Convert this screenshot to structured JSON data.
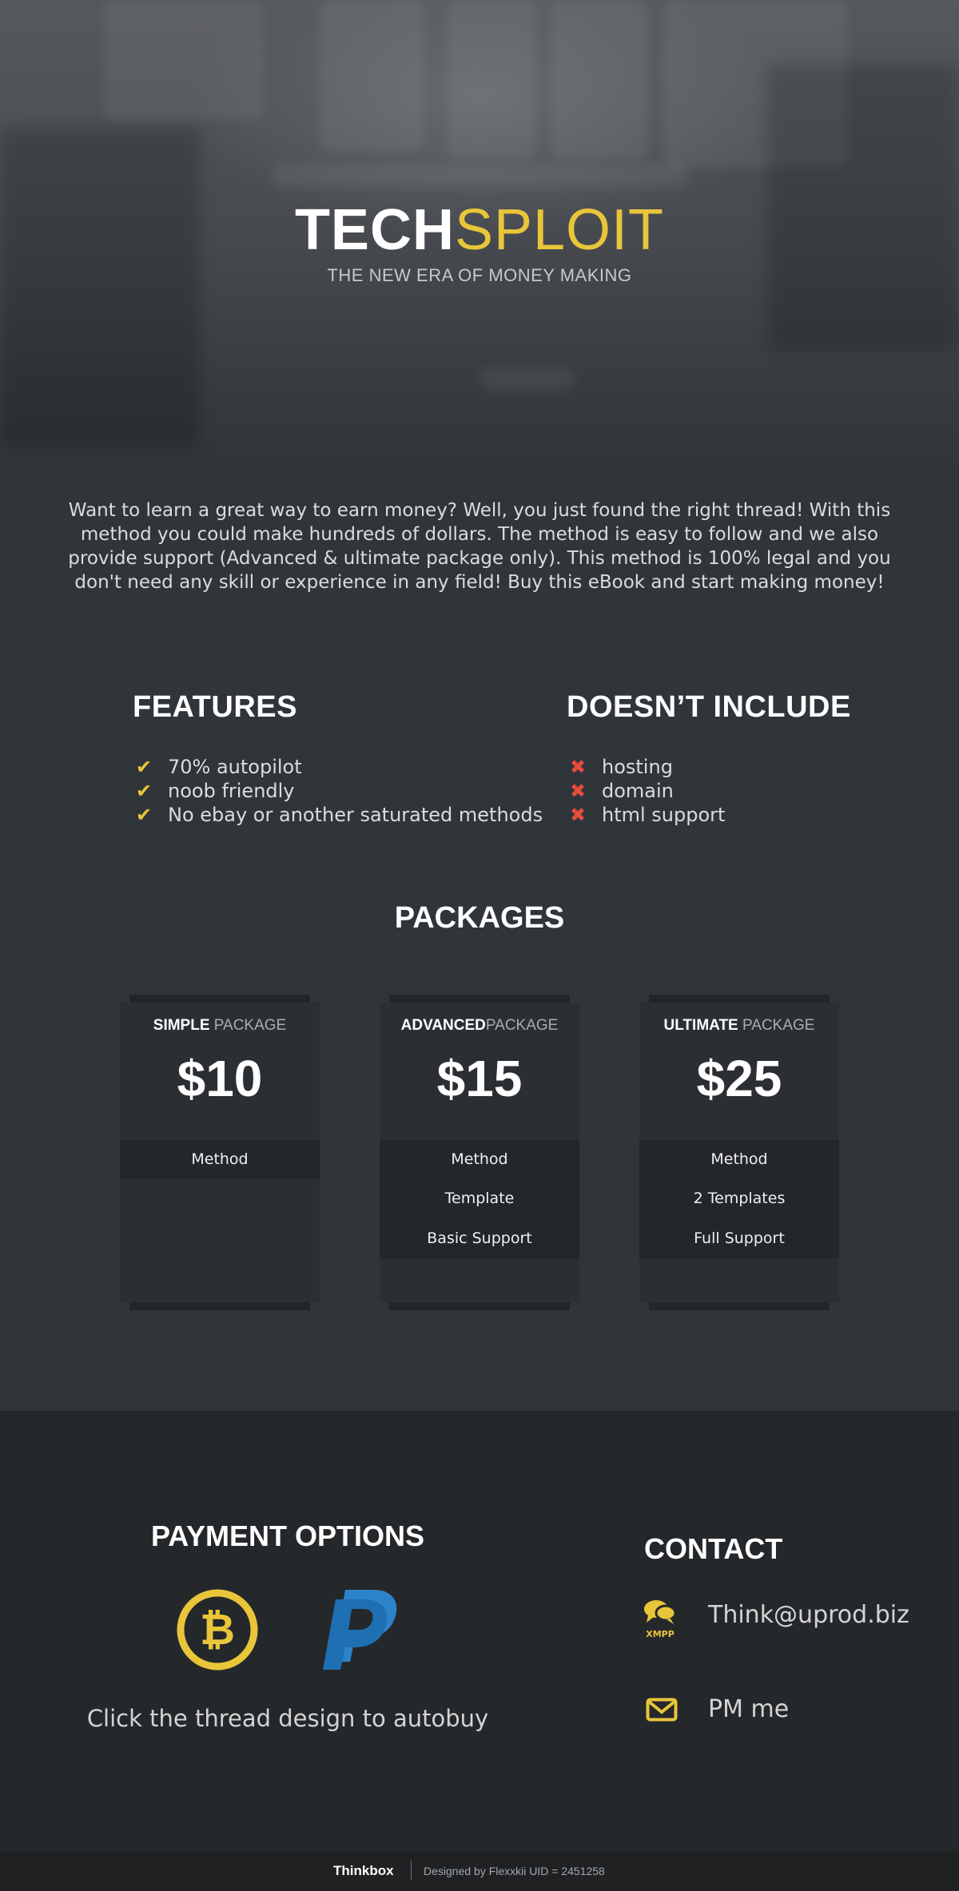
{
  "hero": {
    "logo_strong": "TECH",
    "logo_light": "SPLOIT",
    "tagline": "THE NEW ERA OF MONEY MAKING"
  },
  "intro": {
    "text": "Want to learn a great way to earn money? Well, you just found the right thread! With this method you could make hundreds of dollars. The method is easy to follow and we also provide support (Advanced & ultimate package only). This method is 100% legal and you don't need any skill or experience in any field! Buy this eBook and start making money!"
  },
  "features": {
    "title": "FEATURES",
    "icon": "check-icon",
    "items": [
      "70% autopilot",
      "noob friendly",
      "No ebay or another saturated methods"
    ]
  },
  "excludes": {
    "title": "DOESN’T INCLUDE",
    "icon": "cross-icon",
    "items": [
      "hosting",
      "domain",
      "html support"
    ]
  },
  "packages": {
    "title": "PACKAGES",
    "items": [
      {
        "name_bold": "SIMPLE",
        "name_light": " PACKAGE",
        "price": "$10",
        "features": [
          "Method"
        ]
      },
      {
        "name_bold": "ADVANCED",
        "name_light": "PACKAGE",
        "price": "$15",
        "features": [
          "Method",
          "Template",
          "Basic Support"
        ]
      },
      {
        "name_bold": "ULTIMATE",
        "name_light": " PACKAGE",
        "price": "$25",
        "features": [
          "Method",
          "2 Templates",
          "Full Support"
        ]
      }
    ]
  },
  "payment": {
    "title": "PAYMENT OPTIONS",
    "icons": [
      "bitcoin-icon",
      "paypal-icon"
    ],
    "note": "Click the thread design to autobuy"
  },
  "contact": {
    "title": "CONTACT",
    "xmpp_label": "XMPP",
    "xmpp": "Think@uprod.biz",
    "pm": "PM me"
  },
  "footer": {
    "brand": "Thinkbox",
    "credit": "Designed by Flexxkii UID = 2451258"
  },
  "colors": {
    "accent": "#e9c53a",
    "cross": "#e74c3c",
    "paypal": "#2a7bc1"
  }
}
